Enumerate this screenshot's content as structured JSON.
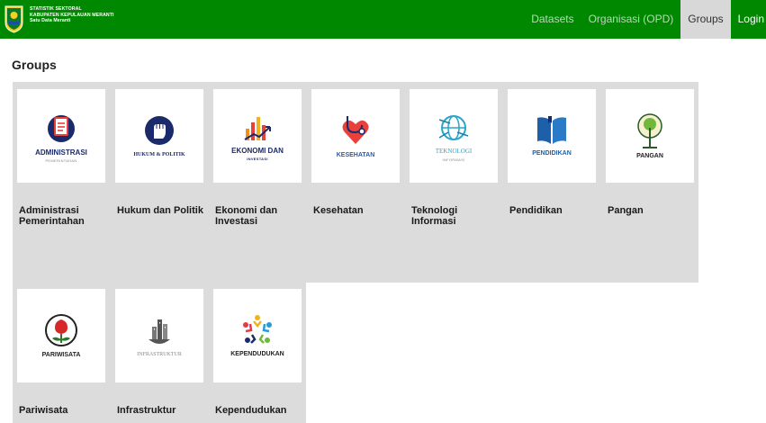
{
  "brand": {
    "line1": "STATISTIK SEKTORAL",
    "line2": "KABUPATEN KEPULAUAN MERANTI",
    "line3": "Satu Data Meranti"
  },
  "nav": {
    "datasets": "Datasets",
    "organisasi": "Organisasi (OPD)",
    "groups": "Groups",
    "login": "Login"
  },
  "page_title": "Groups",
  "groups": [
    {
      "name": "Administrasi Pemerintahan",
      "logo_text": "ADMINISTRASI",
      "logo_sub": "PEMERINTAHAN",
      "icon": "document-icon",
      "color": "#1b2a6b"
    },
    {
      "name": "Hukum dan Politik",
      "logo_text": "HUKUM & POLITIK",
      "icon": "fist-icon",
      "color": "#1b2a6b"
    },
    {
      "name": "Ekonomi dan Investasi",
      "logo_text": "EKONOMI DAN",
      "logo_sub": "INVESTASI",
      "icon": "bar-growth-icon",
      "color": "#f28c1b"
    },
    {
      "name": "Kesehatan",
      "logo_text": "KESEHATAN",
      "icon": "stethoscope-heart-icon",
      "color": "#e8403a"
    },
    {
      "name": "Teknologi Informasi",
      "logo_text": "TEKNOLOGI",
      "logo_sub": "INFORMASI",
      "icon": "globe-network-icon",
      "color": "#2aa5c9"
    },
    {
      "name": "Pendidikan",
      "logo_text": "PENDIDIKAN",
      "icon": "book-icon",
      "color": "#1d5fa8"
    },
    {
      "name": "Pangan",
      "logo_text": "PANGAN",
      "icon": "tree-icon",
      "color": "#3a8a2a"
    },
    {
      "name": "Pariwisata",
      "logo_text": "PARIWISATA",
      "icon": "rose-icon",
      "color": "#d62828"
    },
    {
      "name": "Infrastruktur",
      "logo_text": "INFRASTRUKTUR",
      "icon": "city-icon",
      "color": "#888888"
    },
    {
      "name": "Kependudukan",
      "logo_text": "KEPENDUDUKAN",
      "icon": "people-circle-icon",
      "color": "#e63946"
    }
  ]
}
